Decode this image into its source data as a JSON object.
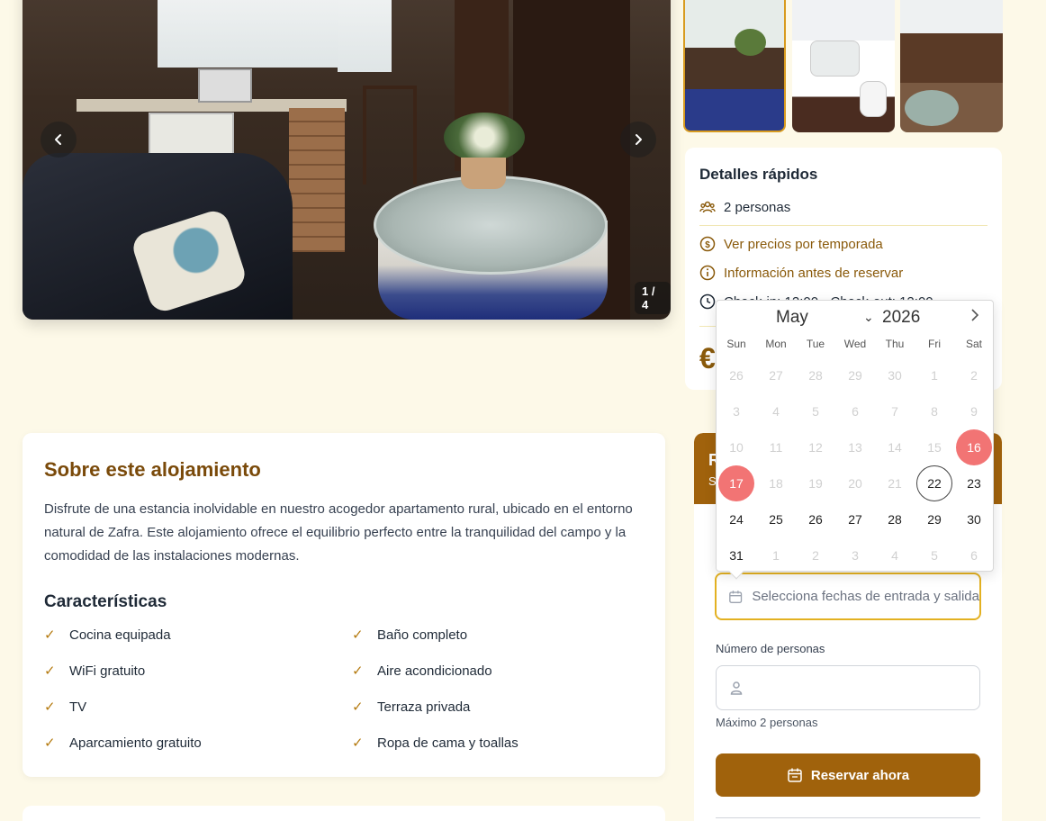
{
  "gallery": {
    "counter": "1 / 4",
    "prev_icon": "chevron-left-icon",
    "next_icon": "chevron-right-icon"
  },
  "quick_details": {
    "title": "Detalles rápidos",
    "people": "2 personas",
    "seasonal_prices": "Ver precios por temporada",
    "info_before": "Información antes de reservar",
    "checkin_partial": "Check-in: 12:00 · Check-out: 12:00",
    "price_symbol": "€"
  },
  "about": {
    "title": "Sobre este alojamiento",
    "description": "Disfrute de una estancia inolvidable en nuestro acogedor apartamento rural, ubicado en el entorno natural de Zafra. Este alojamiento ofrece el equilibrio perfecto entre la tranquilidad del campo y la comodidad de las instalaciones modernas.",
    "features_title": "Características",
    "features": [
      "Cocina equipada",
      "Baño completo",
      "WiFi gratuito",
      "Aire acondicionado",
      "TV",
      "Terraza privada",
      "Aparcamiento gratuito",
      "Ropa de cama y toallas"
    ]
  },
  "booking": {
    "title_partial": "R",
    "subtitle_partial": "S",
    "date_placeholder": "Selecciona fechas de entrada y salida",
    "people_label": "Número de personas",
    "people_value": "",
    "people_hint": "Máximo 2 personas",
    "reserve_label": "Reservar ahora"
  },
  "calendar": {
    "month": "May",
    "year": "2026",
    "weekdays": [
      "Sun",
      "Mon",
      "Tue",
      "Wed",
      "Thu",
      "Fri",
      "Sat"
    ],
    "weeks": [
      [
        "26",
        "27",
        "28",
        "29",
        "30",
        "1",
        "2"
      ],
      [
        "3",
        "4",
        "5",
        "6",
        "7",
        "8",
        "9"
      ],
      [
        "10",
        "11",
        "12",
        "13",
        "14",
        "15",
        "16"
      ],
      [
        "17",
        "18",
        "19",
        "20",
        "21",
        "22",
        "23"
      ],
      [
        "24",
        "25",
        "26",
        "27",
        "28",
        "29",
        "30"
      ],
      [
        "31",
        "1",
        "2",
        "3",
        "4",
        "5",
        "6"
      ]
    ],
    "selected": [
      "16",
      "17"
    ],
    "today": "22",
    "colors": {
      "selected": "#f27474",
      "accent": "#a0620c"
    }
  }
}
